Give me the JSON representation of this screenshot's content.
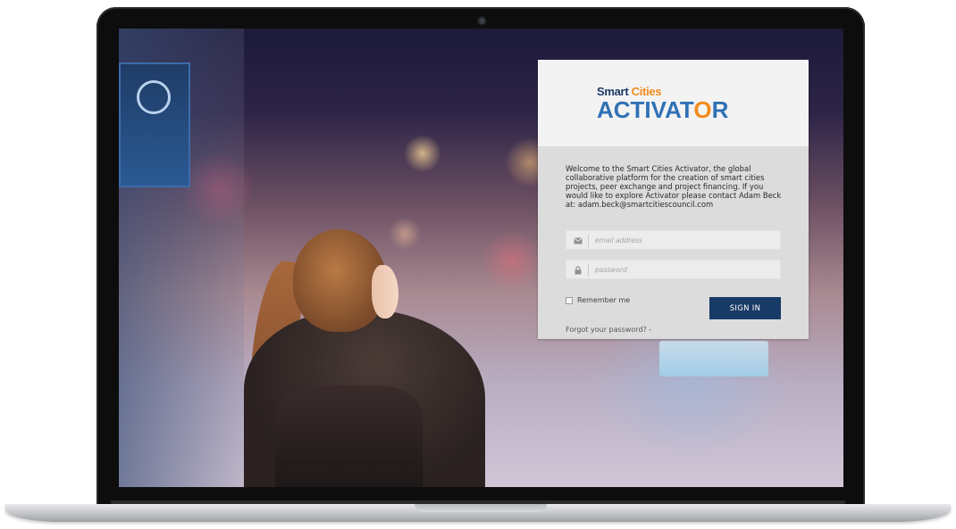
{
  "logo": {
    "small_part1": "Smart ",
    "small_part2": "Cities",
    "big_part1": "ACTIVAT",
    "big_part2": "O",
    "big_part3": "R"
  },
  "welcome_text": "Welcome to the Smart Cities Activator, the global collaborative platform for the creation of smart cities projects, peer exchange and project financing. If you would like to explore Activator please contact Adam Beck at: adam.beck@smartcitiescouncil.com",
  "form": {
    "email_placeholder": "email address",
    "password_placeholder": "password",
    "remember_label": "Remember me",
    "signin_label": "SIGN IN",
    "forgot_label": "Forgot your password? -"
  },
  "icons": {
    "email": "envelope-icon",
    "password": "lock-icon",
    "camera": "webcam-dot"
  },
  "colors": {
    "brand_navy": "#183a66",
    "brand_blue": "#2f71b6",
    "brand_orange": "#f28c1d"
  }
}
